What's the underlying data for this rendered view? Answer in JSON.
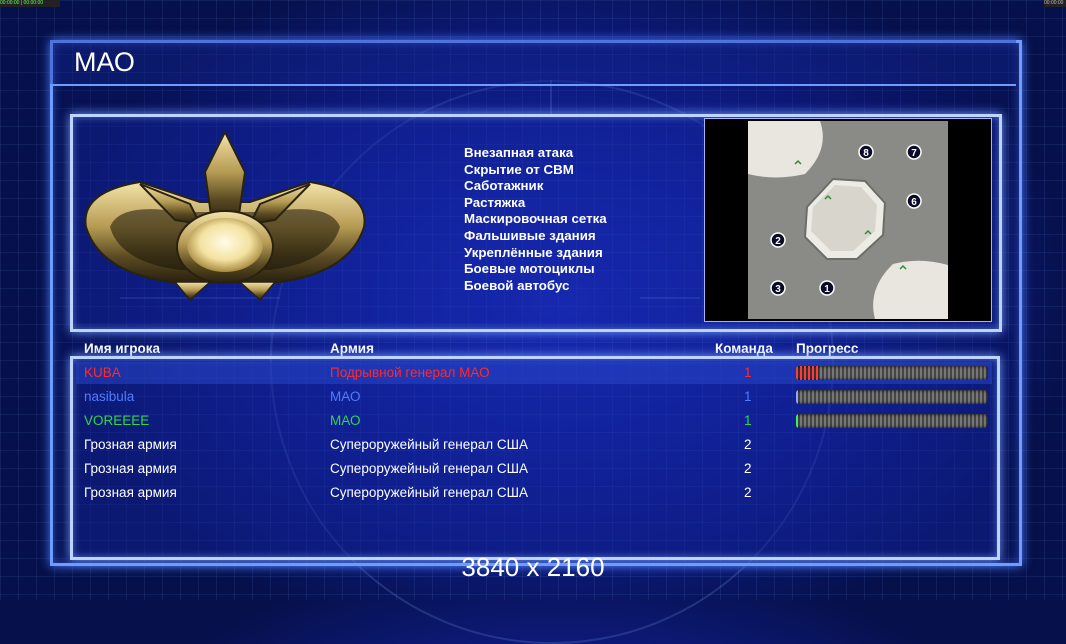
{
  "hud": {
    "top_left": "00:00:00 | 00:00:00",
    "top_right": "00:00:00"
  },
  "title": "МАО",
  "rules": [
    "Внезапная атака",
    "Скрытие от СВМ",
    "Саботажник",
    "Растяжка",
    "Маскировочная сетка",
    "Фальшивые здания",
    "Укреплённые здания",
    "Боевые мотоциклы",
    "Боевой автобус"
  ],
  "map": {
    "spawn_labels": [
      "8",
      "7",
      "6",
      "2",
      "3",
      "1"
    ]
  },
  "columns": {
    "name": "Имя игрока",
    "army": "Армия",
    "team": "Команда",
    "progress": "Прогресс"
  },
  "players": [
    {
      "name": "KUBA",
      "army": "Подрывной генерал МАО",
      "team": "1",
      "color": "#ff2a2a",
      "progress": 0.12,
      "bar_color": "#ff3a3a"
    },
    {
      "name": "nasibula",
      "army": "МАО",
      "team": "1",
      "color": "#4f7cff",
      "progress": 0.01,
      "bar_color": "#8fa8ff"
    },
    {
      "name": "VOREEEE",
      "army": "МАО",
      "team": "1",
      "color": "#2ed84a",
      "progress": 0.01,
      "bar_color": "#3cf05a"
    },
    {
      "name": "Грозная армия",
      "army": "Супероружейный генерал США",
      "team": "2",
      "color": "#ffffff"
    },
    {
      "name": "Грозная армия",
      "army": "Супероружейный генерал США",
      "team": "2",
      "color": "#ffffff"
    },
    {
      "name": "Грозная армия",
      "army": "Супероружейный генерал США",
      "team": "2",
      "color": "#ffffff"
    }
  ],
  "resolution": "3840 x 2160"
}
